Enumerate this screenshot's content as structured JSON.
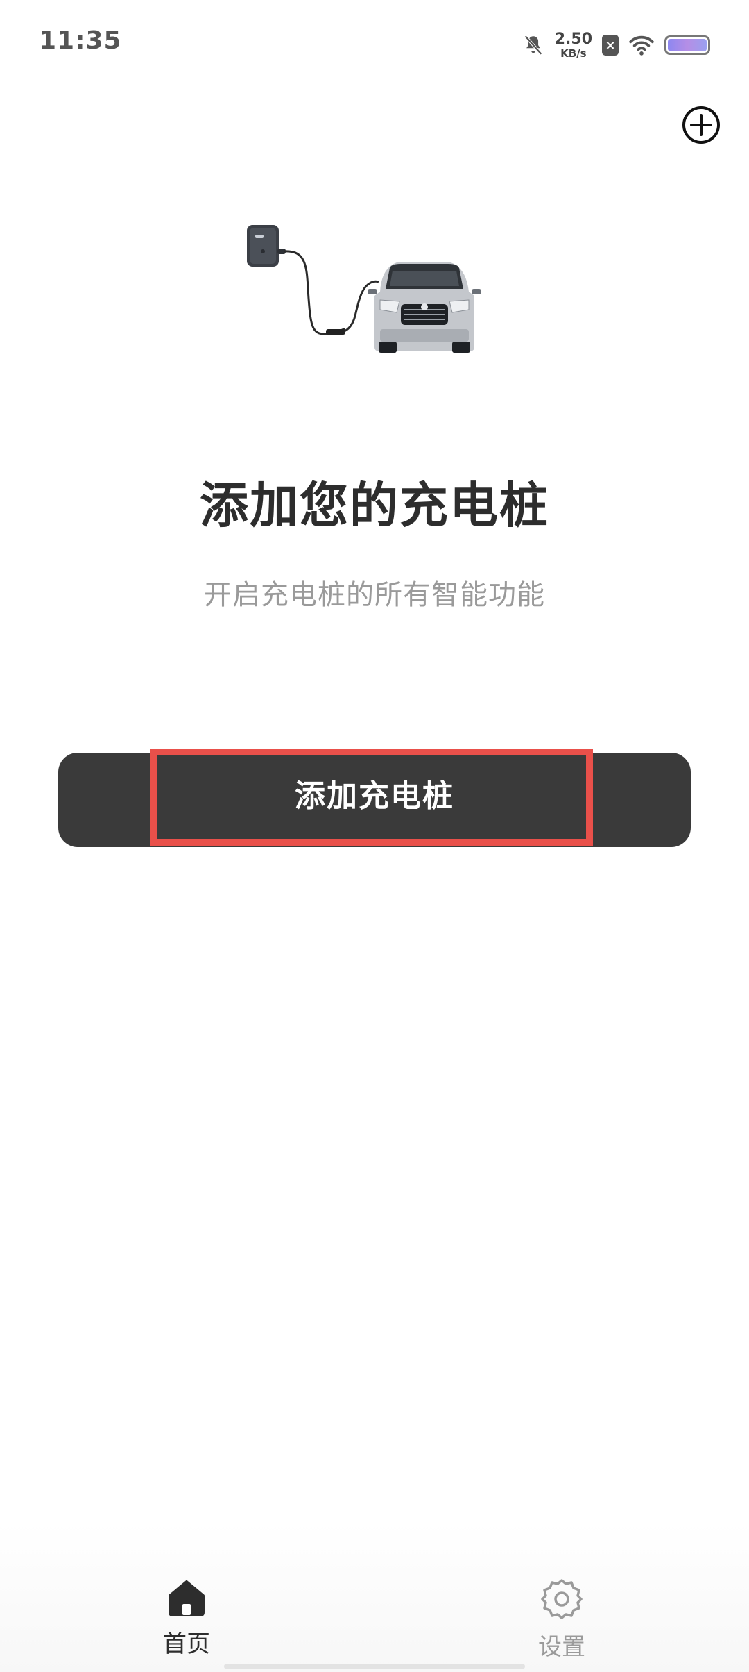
{
  "status_bar": {
    "time": "11:35",
    "net_speed_value": "2.50",
    "net_speed_unit": "KB/s",
    "icons": [
      "bell-muted-icon",
      "sim-x-icon",
      "wifi-icon",
      "battery-icon"
    ]
  },
  "header": {
    "add_icon": "plus-circle-icon"
  },
  "main": {
    "illustration": "charger-and-car-illustration",
    "title": "添加您的充电桩",
    "subtitle": "开启充电桩的所有智能功能",
    "primary_button_label": "添加充电桩"
  },
  "bottom_nav": {
    "items": [
      {
        "label": "首页",
        "icon": "home-icon",
        "active": true
      },
      {
        "label": "设置",
        "icon": "gear-icon",
        "active": false
      }
    ]
  },
  "colors": {
    "button_bg": "#3a3a3a",
    "highlight": "#e9504a",
    "title": "#2d2d2d",
    "subtitle": "#9a9a9a"
  }
}
